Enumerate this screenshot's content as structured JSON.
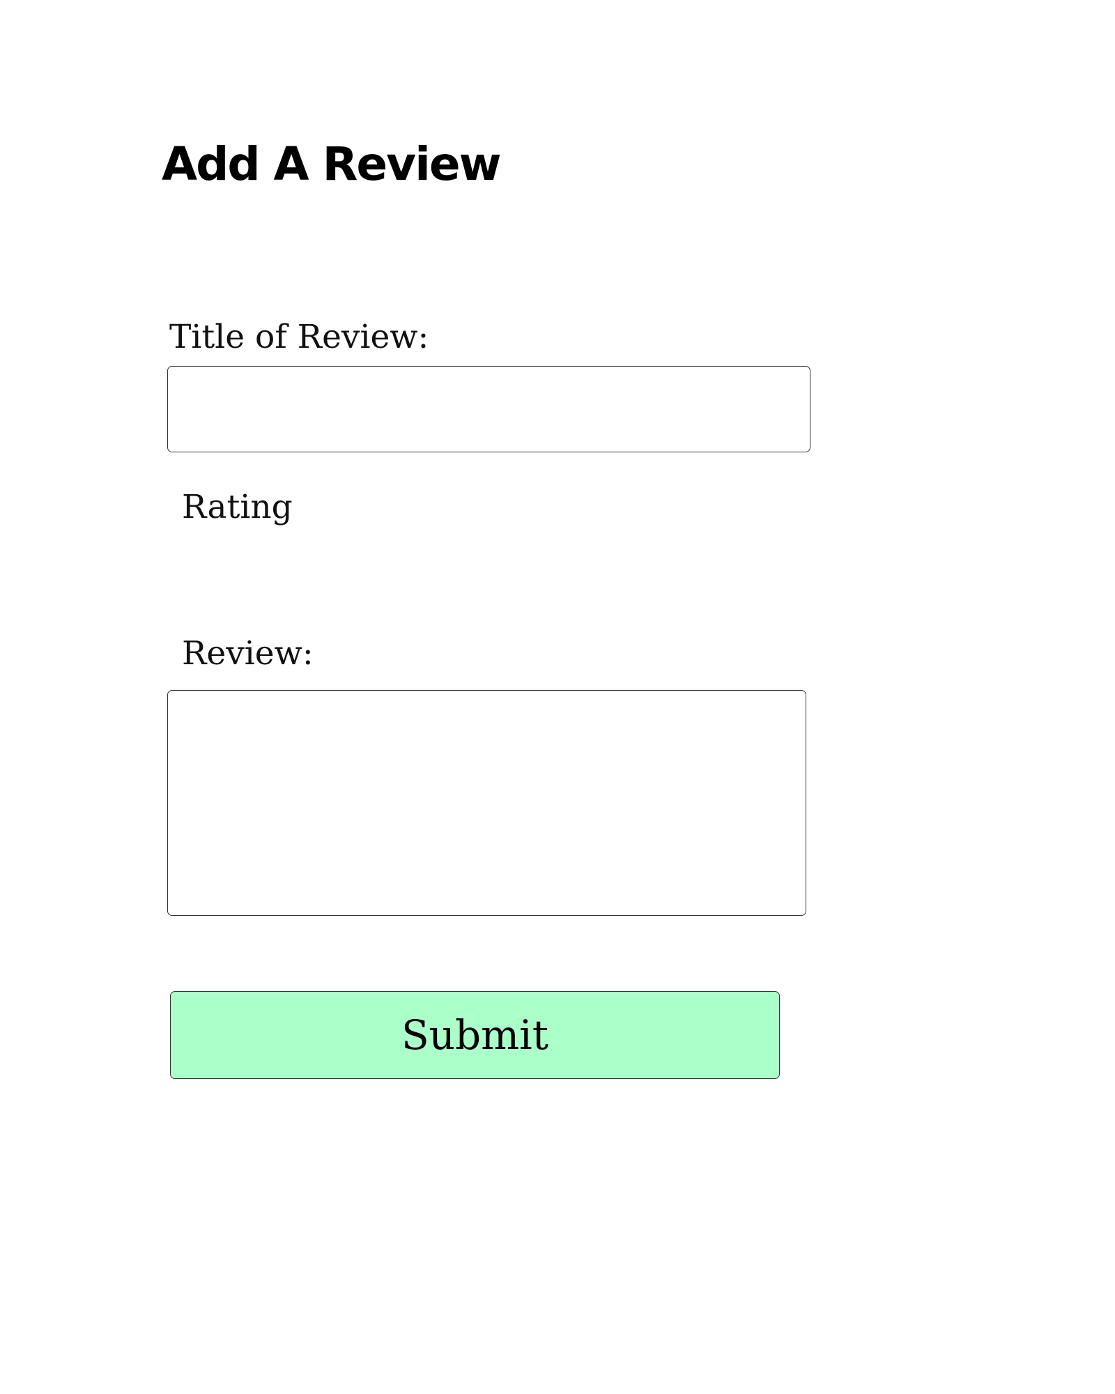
{
  "page": {
    "title": "Add A Review"
  },
  "form": {
    "title_label": "Title of Review:",
    "title_value": "",
    "title_placeholder": "",
    "rating_label": "Rating",
    "review_label": "Review:",
    "review_value": "",
    "review_placeholder": "",
    "submit_label": "Submit"
  },
  "colors": {
    "submit_background": "#abffc9",
    "field_border": "#333333",
    "text": "#000000"
  }
}
